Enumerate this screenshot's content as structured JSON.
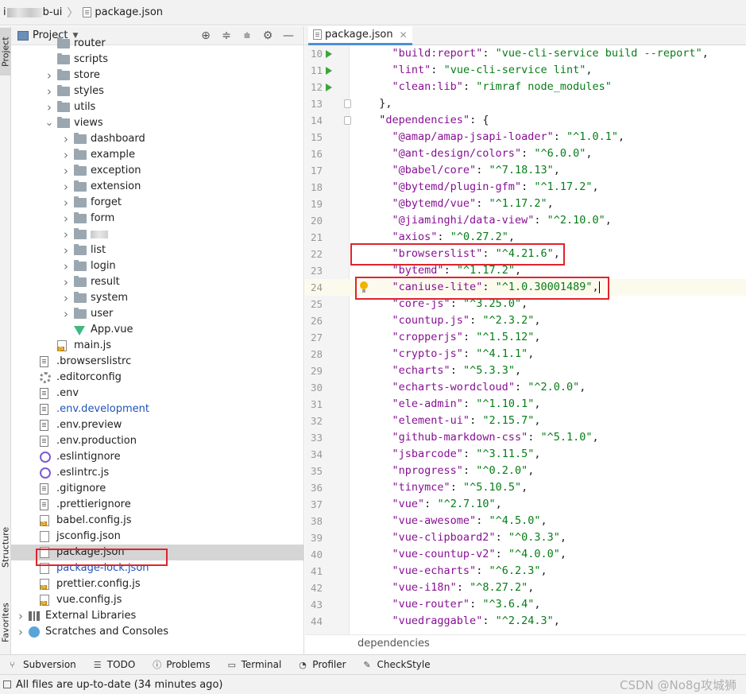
{
  "breadcrumb": {
    "project_prefix": "i",
    "project_suffix": "b-ui",
    "file": "package.json"
  },
  "left_strip": {
    "project_tab": "Project",
    "structure_tab": "Structure",
    "favorites_tab": "Favorites"
  },
  "project_panel": {
    "title": "Project",
    "tree": [
      {
        "label": "router",
        "type": "folder",
        "depth": 2,
        "expandable": false
      },
      {
        "label": "scripts",
        "type": "folder",
        "depth": 2,
        "expandable": false
      },
      {
        "label": "store",
        "type": "folder",
        "depth": 2,
        "expandable": true
      },
      {
        "label": "styles",
        "type": "folder",
        "depth": 2,
        "expandable": true
      },
      {
        "label": "utils",
        "type": "folder",
        "depth": 2,
        "expandable": true
      },
      {
        "label": "views",
        "type": "folder",
        "depth": 2,
        "expandable": true,
        "expanded": true
      },
      {
        "label": "dashboard",
        "type": "folder",
        "depth": 3,
        "expandable": true
      },
      {
        "label": "example",
        "type": "folder",
        "depth": 3,
        "expandable": true
      },
      {
        "label": "exception",
        "type": "folder",
        "depth": 3,
        "expandable": true
      },
      {
        "label": "extension",
        "type": "folder",
        "depth": 3,
        "expandable": true
      },
      {
        "label": "forget",
        "type": "folder",
        "depth": 3,
        "expandable": true
      },
      {
        "label": "form",
        "type": "folder",
        "depth": 3,
        "expandable": true
      },
      {
        "label": "",
        "type": "folder",
        "depth": 3,
        "expandable": true,
        "blurred": true
      },
      {
        "label": "list",
        "type": "folder",
        "depth": 3,
        "expandable": true
      },
      {
        "label": "login",
        "type": "folder",
        "depth": 3,
        "expandable": true
      },
      {
        "label": "result",
        "type": "folder",
        "depth": 3,
        "expandable": true
      },
      {
        "label": "system",
        "type": "folder",
        "depth": 3,
        "expandable": true
      },
      {
        "label": "user",
        "type": "folder",
        "depth": 3,
        "expandable": true
      },
      {
        "label": "App.vue",
        "type": "vue",
        "depth": 3
      },
      {
        "label": "main.js",
        "type": "js",
        "depth": 2
      },
      {
        "label": ".browserslistrc",
        "type": "txt",
        "depth": 1
      },
      {
        "label": ".editorconfig",
        "type": "gear",
        "depth": 1
      },
      {
        "label": ".env",
        "type": "txt",
        "depth": 1
      },
      {
        "label": ".env.development",
        "type": "txt",
        "depth": 1,
        "color": "blue"
      },
      {
        "label": ".env.preview",
        "type": "txt",
        "depth": 1
      },
      {
        "label": ".env.production",
        "type": "txt",
        "depth": 1
      },
      {
        "label": ".eslintignore",
        "type": "eslint",
        "depth": 1
      },
      {
        "label": ".eslintrc.js",
        "type": "eslint",
        "depth": 1
      },
      {
        "label": ".gitignore",
        "type": "txt",
        "depth": 1
      },
      {
        "label": ".prettierignore",
        "type": "txt",
        "depth": 1
      },
      {
        "label": "babel.config.js",
        "type": "js",
        "depth": 1
      },
      {
        "label": "jsconfig.json",
        "type": "json",
        "depth": 1
      },
      {
        "label": "package.json",
        "type": "json",
        "depth": 1,
        "selected": true
      },
      {
        "label": "package-lock.json",
        "type": "json",
        "depth": 1,
        "color": "blue"
      },
      {
        "label": "prettier.config.js",
        "type": "js",
        "depth": 1
      },
      {
        "label": "vue.config.js",
        "type": "js",
        "depth": 1
      },
      {
        "label": "External Libraries",
        "type": "lib",
        "depth": 0,
        "expandable": true
      },
      {
        "label": "Scratches and Consoles",
        "type": "scratch",
        "depth": 0,
        "expandable": true
      }
    ]
  },
  "editor": {
    "tab_label": "package.json",
    "current_line": 24,
    "lines": [
      {
        "n": 10,
        "run": true,
        "key": "build:report",
        "val": "vue-cli-service build --report",
        "trail": ","
      },
      {
        "n": 11,
        "run": true,
        "key": "lint",
        "val": "vue-cli-service lint",
        "trail": ","
      },
      {
        "n": 12,
        "run": true,
        "key": "clean:lib",
        "val": "rimraf node_modules",
        "trail": ""
      },
      {
        "n": 13,
        "raw": "  },",
        "fold": true
      },
      {
        "n": 14,
        "raw_key": "dependencies",
        "raw_open": ": {",
        "indent": "  ",
        "fold": true
      },
      {
        "n": 15,
        "key": "@amap/amap-jsapi-loader",
        "val": "^1.0.1",
        "trail": ","
      },
      {
        "n": 16,
        "key": "@ant-design/colors",
        "val": "^6.0.0",
        "trail": ","
      },
      {
        "n": 17,
        "key": "@babel/core",
        "val": "^7.18.13",
        "trail": ","
      },
      {
        "n": 18,
        "key": "@bytemd/plugin-gfm",
        "val": "^1.17.2",
        "trail": ","
      },
      {
        "n": 19,
        "key": "@bytemd/vue",
        "val": "^1.17.2",
        "trail": ","
      },
      {
        "n": 20,
        "key": "@jiaminghi/data-view",
        "val": "^2.10.0",
        "trail": ","
      },
      {
        "n": 21,
        "key": "axios",
        "val": "^0.27.2",
        "trail": ","
      },
      {
        "n": 22,
        "key": "browserslist",
        "val": "^4.21.6",
        "trail": ","
      },
      {
        "n": 23,
        "key": "bytemd",
        "val": "^1.17.2",
        "trail": ","
      },
      {
        "n": 24,
        "key": "caniuse-lite",
        "val": "^1.0.30001489",
        "trail": ",",
        "bulb": true,
        "caret": true
      },
      {
        "n": 25,
        "key": "core-js",
        "val": "^3.25.0",
        "trail": ","
      },
      {
        "n": 26,
        "key": "countup.js",
        "val": "^2.3.2",
        "trail": ","
      },
      {
        "n": 27,
        "key": "cropperjs",
        "val": "^1.5.12",
        "trail": ","
      },
      {
        "n": 28,
        "key": "crypto-js",
        "val": "^4.1.1",
        "trail": ","
      },
      {
        "n": 29,
        "key": "echarts",
        "val": "^5.3.3",
        "trail": ","
      },
      {
        "n": 30,
        "key": "echarts-wordcloud",
        "val": "^2.0.0",
        "trail": ","
      },
      {
        "n": 31,
        "key": "ele-admin",
        "val": "^1.10.1",
        "trail": ","
      },
      {
        "n": 32,
        "key": "element-ui",
        "val": "2.15.7",
        "trail": ","
      },
      {
        "n": 33,
        "key": "github-markdown-css",
        "val": "^5.1.0",
        "trail": ","
      },
      {
        "n": 34,
        "key": "jsbarcode",
        "val": "^3.11.5",
        "trail": ","
      },
      {
        "n": 35,
        "key": "nprogress",
        "val": "^0.2.0",
        "trail": ","
      },
      {
        "n": 36,
        "key": "tinymce",
        "val": "^5.10.5",
        "trail": ","
      },
      {
        "n": 37,
        "key": "vue",
        "val": "^2.7.10",
        "trail": ","
      },
      {
        "n": 38,
        "key": "vue-awesome",
        "val": "^4.5.0",
        "trail": ","
      },
      {
        "n": 39,
        "key": "vue-clipboard2",
        "val": "^0.3.3",
        "trail": ","
      },
      {
        "n": 40,
        "key": "vue-countup-v2",
        "val": "^4.0.0",
        "trail": ","
      },
      {
        "n": 41,
        "key": "vue-echarts",
        "val": "^6.2.3",
        "trail": ","
      },
      {
        "n": 42,
        "key": "vue-i18n",
        "val": "^8.27.2",
        "trail": ","
      },
      {
        "n": 43,
        "key": "vue-router",
        "val": "^3.6.4",
        "trail": ","
      },
      {
        "n": 44,
        "key": "vuedraggable",
        "val": "^2.24.3",
        "trail": ","
      }
    ],
    "breadcrumb": "dependencies"
  },
  "toolwindows": [
    {
      "label": "Subversion",
      "icon": "subversion-icon"
    },
    {
      "label": "TODO",
      "icon": "todo-icon"
    },
    {
      "label": "Problems",
      "icon": "problems-icon"
    },
    {
      "label": "Terminal",
      "icon": "terminal-icon"
    },
    {
      "label": "Profiler",
      "icon": "profiler-icon"
    },
    {
      "label": "CheckStyle",
      "icon": "checkstyle-icon"
    }
  ],
  "status": {
    "message": "All files are up-to-date (34 minutes ago)",
    "watermark": "CSDN @No8g攻城狮"
  },
  "colors": {
    "highlight_box": "#e0242c",
    "string": "#067d17",
    "key": "#871094",
    "selection": "#d5d5d5",
    "current_line": "#fcfaed"
  }
}
